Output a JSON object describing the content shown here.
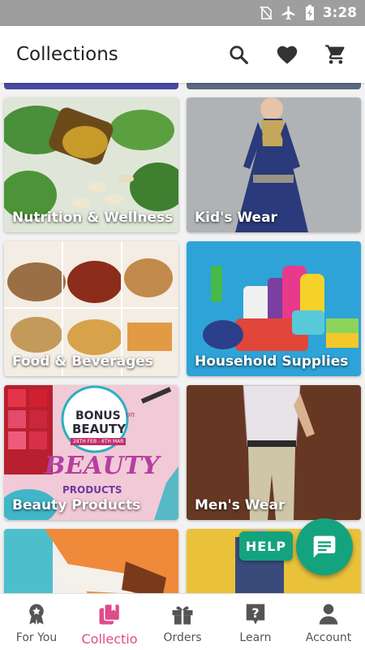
{
  "status_bar": {
    "time": "3:28",
    "icons": [
      "no-sim-icon",
      "airplane-icon",
      "battery-charging-icon"
    ]
  },
  "header": {
    "title": "Collections",
    "actions": [
      "search-icon",
      "heart-icon",
      "cart-icon"
    ]
  },
  "collections": [
    {
      "label": "Nutrition & Wellness"
    },
    {
      "label": "Kid's Wear"
    },
    {
      "label": "Food & Beverages"
    },
    {
      "label": "Household Supplies"
    },
    {
      "label": "Beauty Products"
    },
    {
      "label": "Men's Wear"
    }
  ],
  "beauty_banner": {
    "line1": "BONUS",
    "line2": "on",
    "line3": "BEAUTY",
    "dates": "28TH FEB - 6TH MAR",
    "script": "BEAUTY",
    "sub": "PRODUCTS"
  },
  "help_button": {
    "label": "HELP"
  },
  "bottom_nav": {
    "items": [
      {
        "label": "For You",
        "icon": "award-icon"
      },
      {
        "label": "Collectio",
        "icon": "collections-icon"
      },
      {
        "label": "Orders",
        "icon": "gift-icon"
      },
      {
        "label": "Learn",
        "icon": "help-icon"
      },
      {
        "label": "Account",
        "icon": "account-icon"
      }
    ]
  },
  "colors": {
    "accent": "#e04a8a",
    "help_green": "#14a37f",
    "status_bar": "#9e9e9e"
  }
}
